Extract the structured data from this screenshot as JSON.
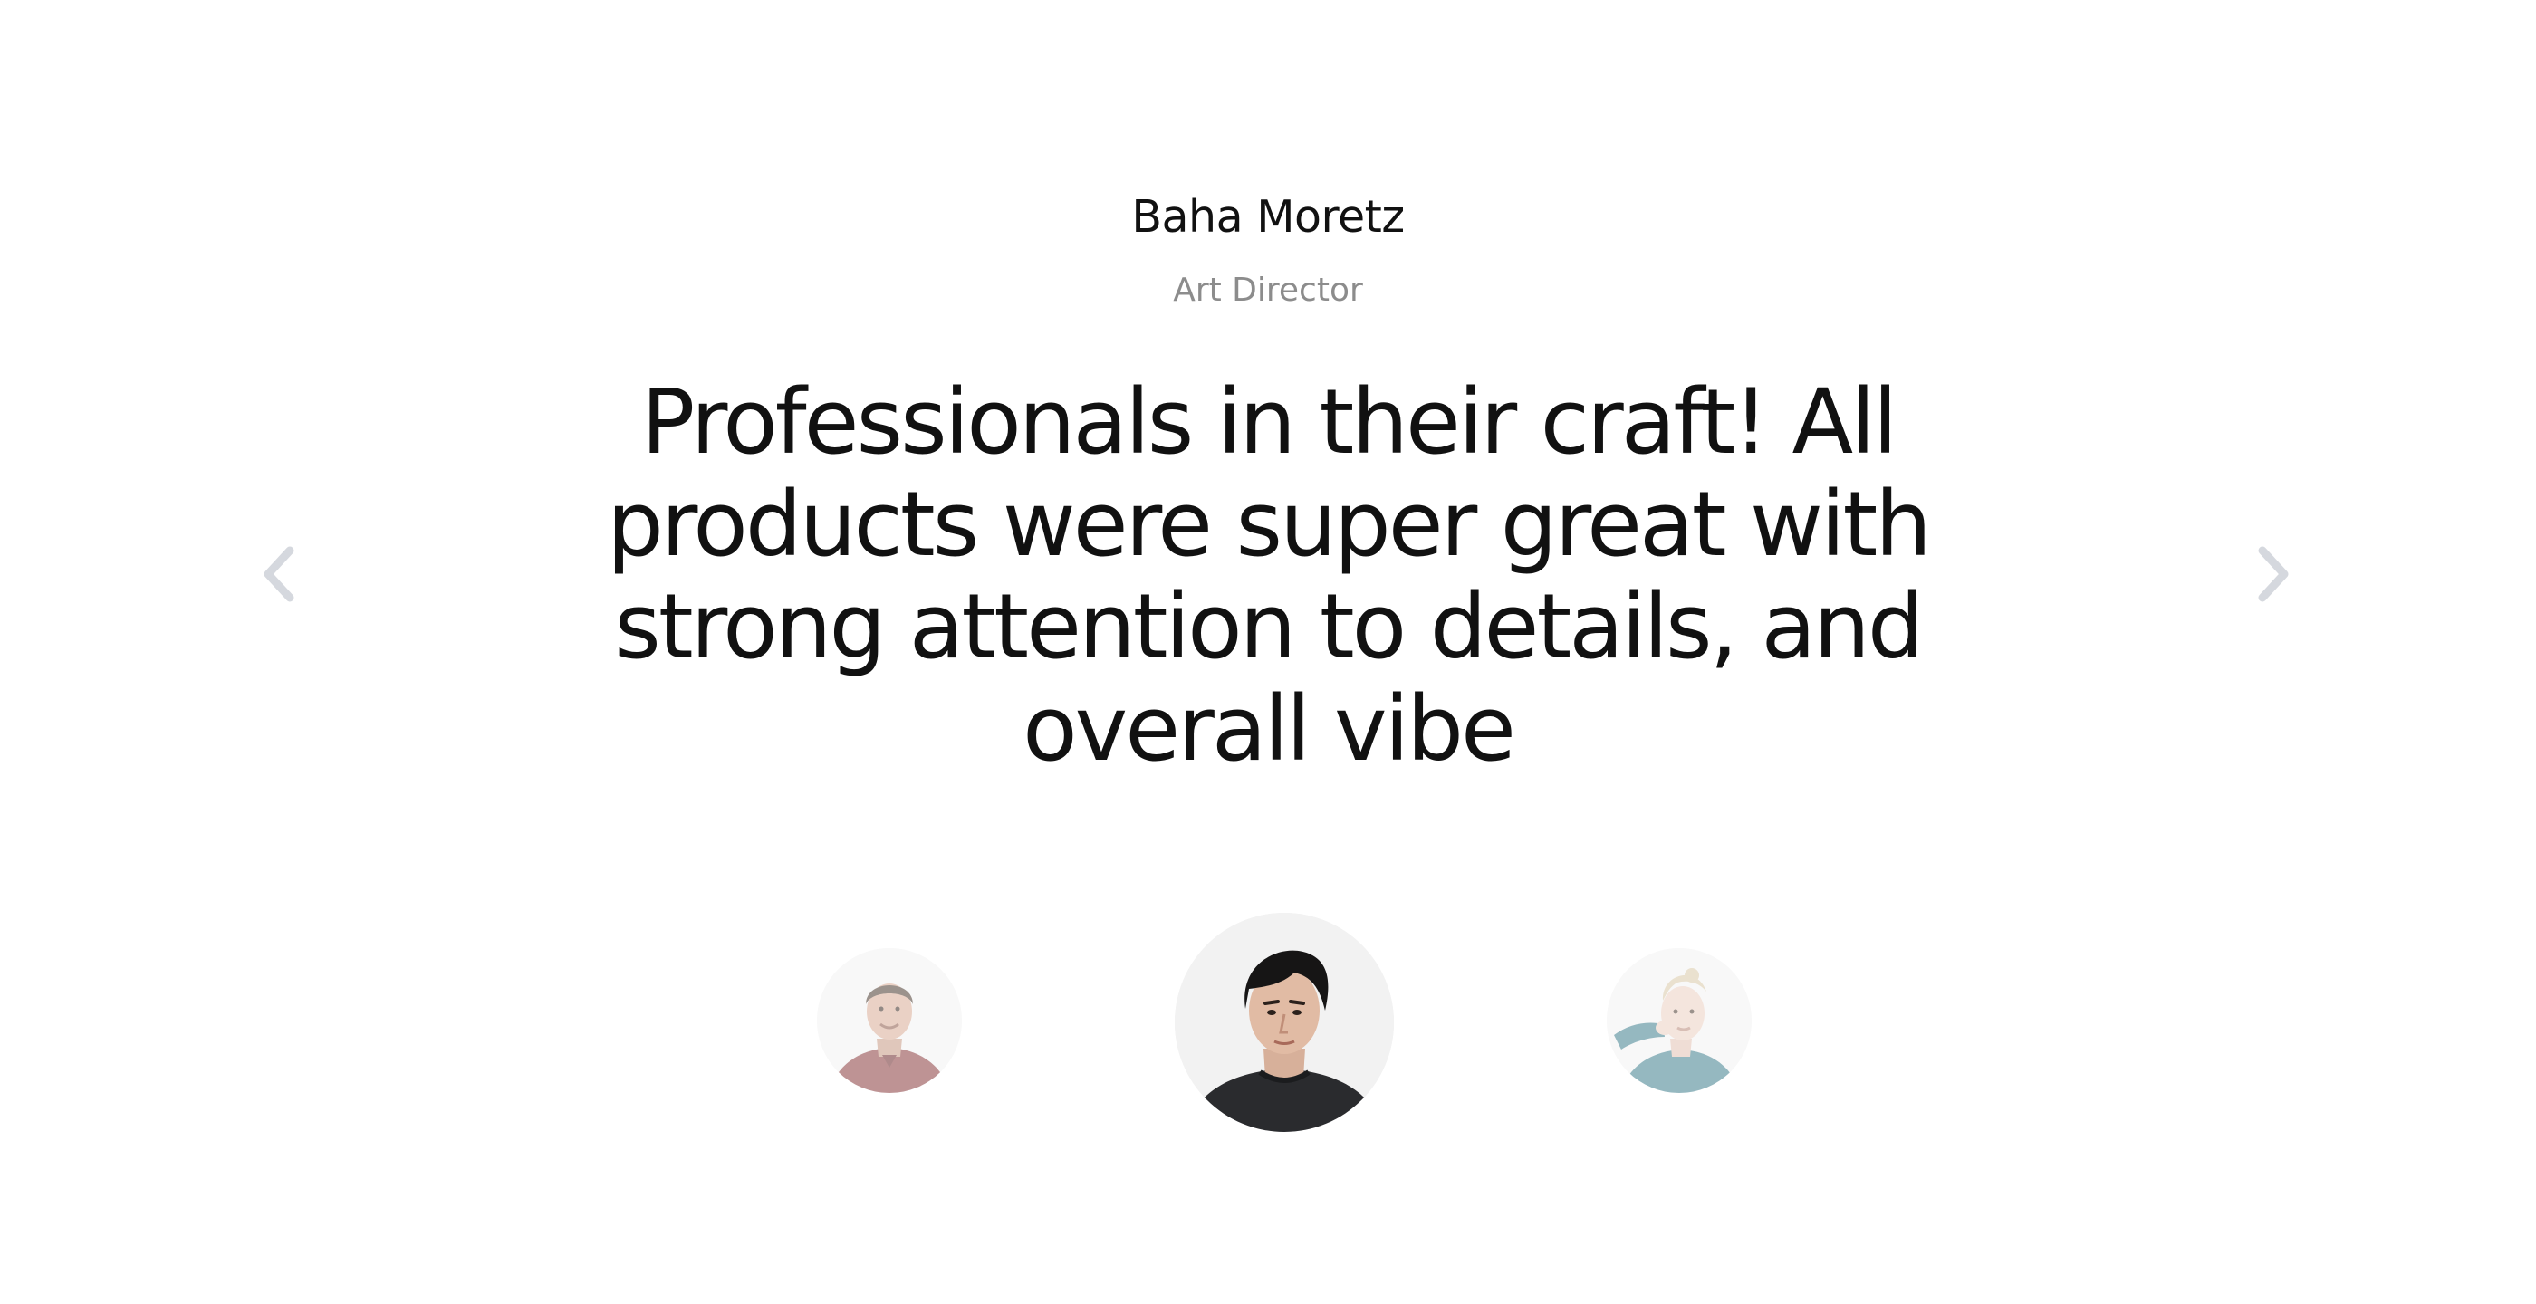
{
  "testimonial": {
    "author_name": "Baha Moretz",
    "author_role": "Art Director",
    "quote": "Professionals in their craft! All products were super great with strong attention to details, and overall vibe"
  },
  "navigation": {
    "prev_icon": "chevron-left-icon",
    "next_icon": "chevron-right-icon",
    "arrow_color": "#d5d8de"
  },
  "avatars": [
    {
      "name": "avatar-left",
      "active": false
    },
    {
      "name": "avatar-center",
      "active": true
    },
    {
      "name": "avatar-right",
      "active": false
    }
  ],
  "colors": {
    "text_primary": "#111111",
    "text_secondary": "#8c8c8c",
    "background": "#ffffff"
  }
}
